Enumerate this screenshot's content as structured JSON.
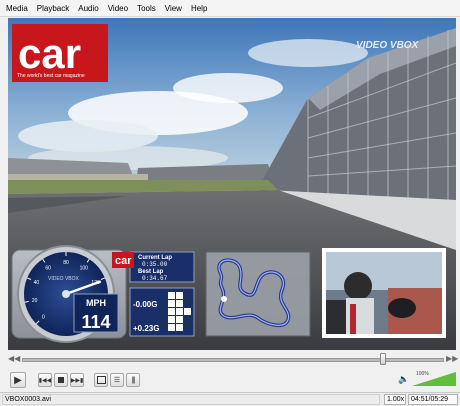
{
  "menu": [
    "Media",
    "Playback",
    "Audio",
    "Video",
    "Tools",
    "View",
    "Help"
  ],
  "overlay": {
    "logo_car": "car",
    "logo_tagline": "The world's best car magazine",
    "vbox_logo": "VIDEO VBOX",
    "gauge_brand": "VIDEO VBOX",
    "speed_unit": "MPH",
    "speed_value": "114",
    "speed_fraction": 0.76,
    "gauge_ticks": [
      "0",
      "20",
      "40",
      "60",
      "80",
      "100",
      "120",
      "140",
      "160"
    ],
    "mini_logo": "car",
    "current_lap_label": "Current Lap",
    "current_lap_time": "0:35.00",
    "best_lap_label": "Best Lap",
    "best_lap_time": "0:34.67",
    "g_long": "-0.00G",
    "g_lat": "+0.23G"
  },
  "player": {
    "seek_fraction": 0.86,
    "volume_label": "100%",
    "volume_fraction": 1.0
  },
  "status": {
    "filename": "VBOX0003.avi",
    "speed": "1.00x",
    "time": "04:51/05:29"
  }
}
